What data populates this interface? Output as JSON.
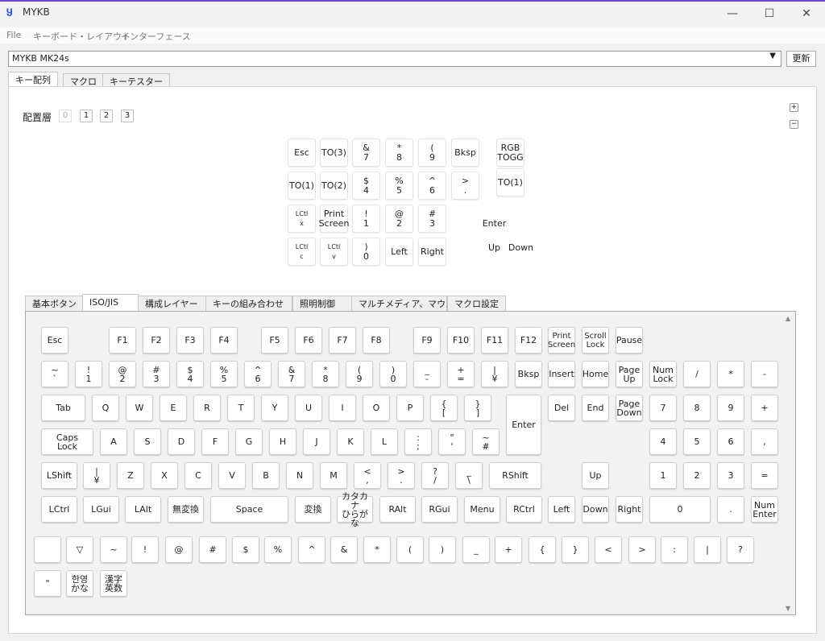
{
  "window": {
    "title": "MYKB",
    "minimize": "—",
    "maximize": "☐",
    "close": "✕"
  },
  "menu": [
    "File",
    "キーボード・レイアウト",
    "インターフェース"
  ],
  "device": {
    "selected": "MYKB MK24s",
    "refresh": "更新"
  },
  "tabs": [
    "キー配列",
    "マクロ",
    "キーテスター"
  ],
  "layers": {
    "label": "配置層",
    "items": [
      "0",
      "1",
      "2",
      "3"
    ],
    "active": "0"
  },
  "zoom": {
    "in": "+",
    "out": "−"
  },
  "layout_keys": [
    {
      "label": "Esc"
    },
    {
      "label": "TO(3)"
    },
    {
      "label": "&\n7"
    },
    {
      "label": "*\n8"
    },
    {
      "label": "(\n9"
    },
    {
      "label": "Bksp"
    },
    {
      "label": "RGB\nTOGG"
    },
    {
      "label": "TO(1)"
    },
    {
      "label": "TO(2)"
    },
    {
      "label": "$\n4"
    },
    {
      "label": "%\n5"
    },
    {
      "label": "^\n6"
    },
    {
      "label": ">\n."
    },
    {
      "label": "TO(1)"
    },
    {
      "label": "LCtl\nx"
    },
    {
      "label": "Print\nScreen"
    },
    {
      "label": "!\n1"
    },
    {
      "label": "@\n2"
    },
    {
      "label": "#\n3"
    },
    {
      "label": "Enter"
    },
    {
      "label": "LCtl\nc"
    },
    {
      "label": "LCtl\nv"
    },
    {
      "label": ")\n0"
    },
    {
      "label": "Left"
    },
    {
      "label": "Right"
    },
    {
      "label": "Up"
    },
    {
      "label": "Down"
    }
  ],
  "key_tabs": [
    "基本ボタン",
    "ISO/JIS",
    "構成レイヤー",
    "キーの組み合わせ",
    "照明制御",
    "マルチメディア、マウス",
    "マクロ設定"
  ],
  "active_key_tab": "ISO/JIS",
  "keys": [
    "Esc",
    "F1",
    "F2",
    "F3",
    "F4",
    "F5",
    "F6",
    "F7",
    "F8",
    "F9",
    "F10",
    "F11",
    "F12",
    "Print\nScreen",
    "Scroll\nLock",
    "Pause",
    "~\n`",
    "!\n1",
    "@\n2",
    "#\n3",
    "$\n4",
    "%\n5",
    "^\n6",
    "&\n7",
    "*\n8",
    "(\n9",
    ")\n0",
    "_\n-",
    "+\n=",
    "|\n¥",
    "Bksp",
    "Insert",
    "Home",
    "Page\nUp",
    "Num\nLock",
    "/",
    "*",
    "-",
    "Tab",
    "Q",
    "W",
    "E",
    "R",
    "T",
    "Y",
    "U",
    "I",
    "O",
    "P",
    "{\n[",
    "}\n]",
    "Enter",
    "Del",
    "End",
    "Page\nDown",
    "7",
    "8",
    "9",
    "+",
    "Caps\nLock",
    "A",
    "S",
    "D",
    "F",
    "G",
    "H",
    "J",
    "K",
    "L",
    ":\n;",
    "\"\n'",
    "~\n#",
    "4",
    "5",
    "6",
    ",",
    "LShift",
    "|\n¥",
    "Z",
    "X",
    "C",
    "V",
    "B",
    "N",
    "M",
    "<\n,",
    ">\n.",
    "?\n/",
    "_\n\\",
    "RShift",
    "Up",
    "1",
    "2",
    "3",
    "=",
    "LCtrl",
    "LGui",
    "LAlt",
    "無変換",
    "Space",
    "変換",
    "カタカナ\nひらがな",
    "RAlt",
    "RGui",
    "Menu",
    "RCtrl",
    "Left",
    "Down",
    "Right",
    "0",
    ".",
    "Num\nEnter",
    "",
    "▽",
    "~",
    "!",
    "@",
    "#",
    "$",
    "%",
    "^",
    "&",
    "*",
    "(",
    ")",
    "_",
    "+",
    "{",
    "}",
    "<",
    ">",
    ":",
    "|",
    "?",
    "\"",
    "한영\nかな",
    "漢字\n英数"
  ]
}
